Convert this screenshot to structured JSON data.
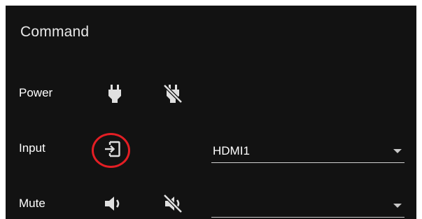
{
  "panel": {
    "title": "Command"
  },
  "rows": {
    "power": {
      "label": "Power",
      "on_icon": "power-plug-icon",
      "off_icon": "power-plug-off-icon"
    },
    "input": {
      "label": "Input",
      "icon": "input-icon",
      "select_value": "HDMI1"
    },
    "mute": {
      "label": "Mute",
      "on_icon": "volume-icon",
      "off_icon": "volume-mute-icon",
      "select_value": ""
    }
  },
  "colors": {
    "panel_background": "#121212",
    "text": "#ffffff",
    "icon": "#e0e0e0",
    "highlight": "#e31e24"
  }
}
